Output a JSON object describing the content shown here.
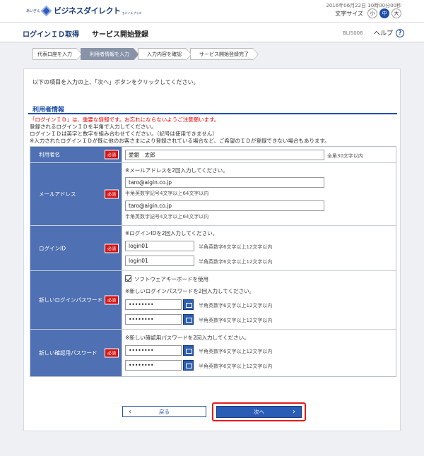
{
  "header": {
    "logo_small": "あいぎん",
    "logo_name": "ビジネスダイレクト",
    "logo_tm": "モバイルプラス",
    "datetime": "2016年06月22日 10時00分00秒",
    "font_size_label": "文字サイズ",
    "font_sizes": [
      "小",
      "中",
      "大"
    ],
    "font_size_selected": "中"
  },
  "titlebar": {
    "main": "ログインＩＤ取得",
    "sub": "サービス開始登録",
    "screen_id": "BLIS006",
    "help_label": "ヘルプ",
    "help_icon": "?"
  },
  "steps": [
    "代表口座を入力",
    "利用者情報を入力",
    "入力内容を確認",
    "サービス開始登録完了"
  ],
  "instruction": "以下の項目を入力の上、「次へ」ボタンをクリックしてください。",
  "section_title": "利用者情報",
  "notes": {
    "warning": "「ログインＩＤ」は、重要な情報です。お忘れにならないようご注意願います。",
    "line1": "登録されるログインＩＤを半角で入力してください。",
    "line2": "ログインＩＤは英字と数字を組み合わせてください。（記号は使用できません）",
    "line3": "※入力されたログインＩＤが既に他のお客さまにより登録されている場合など、ご希望のＩＤが登録できない場合もあります。"
  },
  "required_label": "必須",
  "form": {
    "user_name": {
      "label": "利用者名",
      "value": "愛銀　太郎",
      "hint": "全角30文字以内"
    },
    "email": {
      "label": "メールアドレス",
      "instruction": "※メールアドレスを2回入力してください。",
      "value1": "taro@aigin.co.jp",
      "hint1": "半角英数字記号4文字以上64文字以内",
      "value2": "taro@aigin.co.jp",
      "hint2": "半角英数字記号4文字以上64文字以内"
    },
    "login_id": {
      "label": "ログインID",
      "instruction": "※ログインIDを2回入力してください。",
      "value1": "login01",
      "hint1": "半角英数字6文字以上12文字以内",
      "value2": "login01",
      "hint2": "半角英数字6文字以上12文字以内"
    },
    "new_login_password": {
      "label": "新しいログインパスワード",
      "checkbox_label": "ソフトウェアキーボードを使用",
      "instruction": "※新しいログインパスワードを2回入力してください。",
      "value1": "••••••••",
      "hint1": "半角英数字6文字以上12文字以内",
      "value2": "••••••••",
      "hint2": "半角英数字6文字以上12文字以内"
    },
    "new_confirm_password": {
      "label": "新しい確認用パスワード",
      "instruction": "※新しい確認用パスワードを2回入力してください。",
      "value1": "••••••••",
      "hint1": "半角英数字6文字以上12文字以内",
      "value2": "••••••••",
      "hint2": "半角英数字6文字以上12文字以内"
    }
  },
  "buttons": {
    "back": "戻る",
    "next": "次へ"
  }
}
